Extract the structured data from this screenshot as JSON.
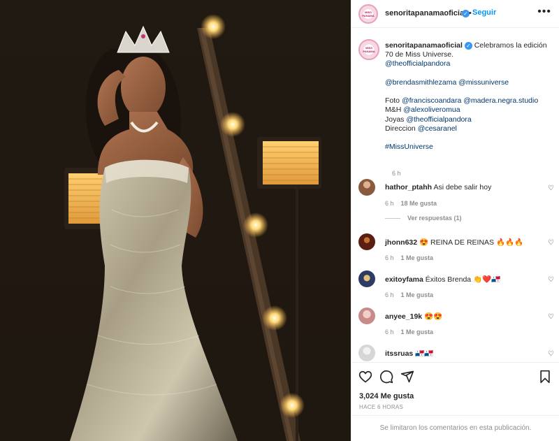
{
  "post": {
    "username": "senoritapanamaoficial",
    "follow_label": "Seguir",
    "more_label": "•••",
    "avatar_text": "MISS PANAMA"
  },
  "caption": {
    "username": "senoritapanamaoficial",
    "text_1": "Celebramos la edición",
    "text_2": "70 de Miss Universe.",
    "mention_pandora": "@theofficialpandora",
    "mentions_line": "@brendasmithlezama @missuniverse",
    "foto_label": "Foto",
    "foto_mentions": "@franciscoandara @madera.negra.studio",
    "mh_label": "M&H",
    "mh_mention": "@alexoliveromua",
    "joyas_label": "Joyas",
    "joyas_mention": "@theofficialpandora",
    "direccion_label": "Direccion",
    "direccion_mention": "@cesaranel",
    "hashtag": "#MissUniverse",
    "time": "6 h"
  },
  "comments": [
    {
      "username": "hathor_ptahh",
      "text": "Asi debe salir hoy",
      "time": "6 h",
      "likes": "18 Me gusta",
      "avatar_color": "#8a5a3c"
    },
    {
      "username": "jhonn632",
      "text": "😍 REINA DE REINAS 🔥🔥🔥",
      "time": "6 h",
      "likes": "1 Me gusta",
      "avatar_color": "#5a1f12"
    },
    {
      "username": "exitoyfama",
      "text": "Éxitos Brenda 👏❤️🇵🇦",
      "time": "6 h",
      "likes": "1 Me gusta",
      "avatar_color": "#2d3c63"
    },
    {
      "username": "anyee_19k",
      "text": "😍😍",
      "time": "6 h",
      "likes": "1 Me gusta",
      "avatar_color": "#c98a8a"
    },
    {
      "username": "itssruas",
      "text": "🇵🇦🇵🇦",
      "time": "",
      "likes": "",
      "avatar_color": "#d6d6d6"
    }
  ],
  "replies_label": "Ver respuestas (1)",
  "actions": {
    "likes": "3,024 Me gusta",
    "ago": "HACE 6 HORAS",
    "limited": "Se limitaron los comentarios en esta publicación."
  },
  "icons": {
    "heart": "heart-icon",
    "comment": "comment-icon",
    "share": "share-icon",
    "save": "bookmark-icon",
    "verified": "verified-badge-icon",
    "more": "more-options-icon"
  },
  "colors": {
    "accent": "#0095f6",
    "link": "#00376b",
    "muted": "#8e8e8e",
    "verified": "#3897f0"
  }
}
